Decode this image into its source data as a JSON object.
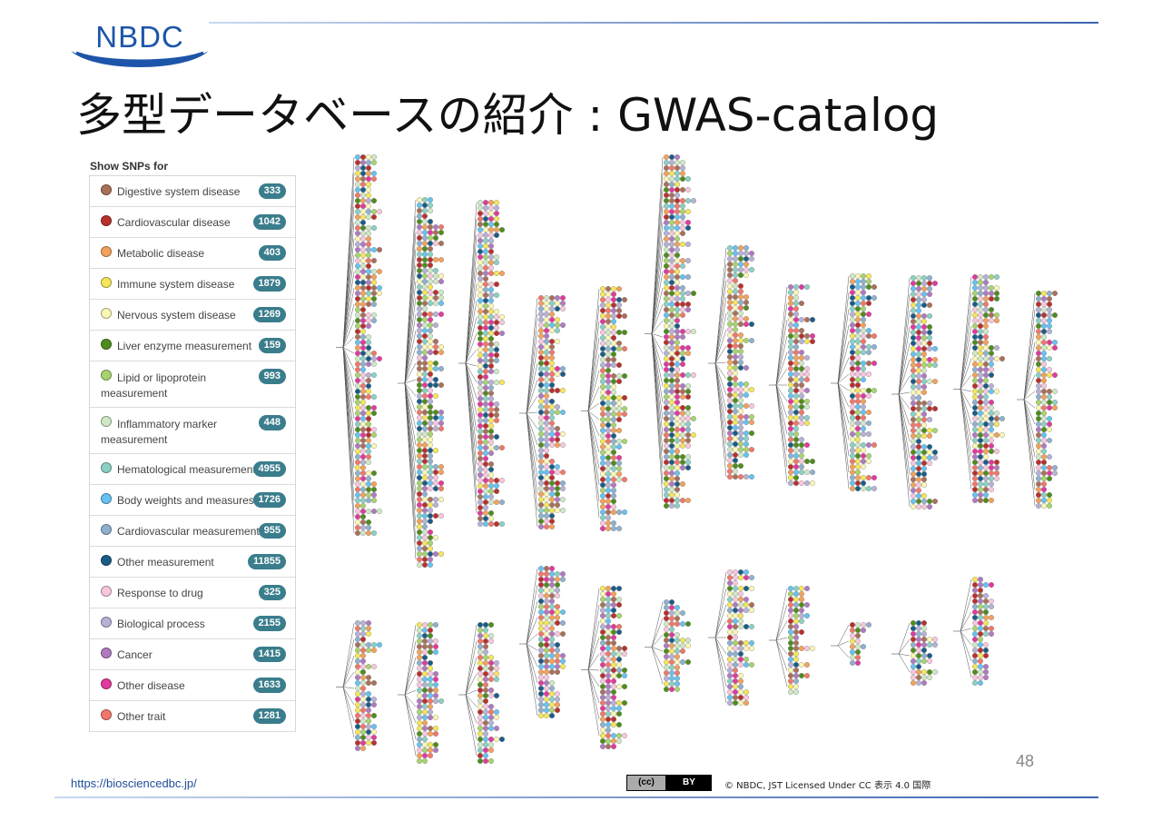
{
  "logo": {
    "text": "NBDC",
    "color": "#1c55a9"
  },
  "title": "多型データベースの紹介 : GWAS-catalog",
  "panel": {
    "heading": "Show SNPs for",
    "items": [
      {
        "label": "Digestive system disease",
        "count": "333",
        "color": "#a9705a"
      },
      {
        "label": "Cardiovascular disease",
        "count": "1042",
        "color": "#b8312f"
      },
      {
        "label": "Metabolic disease",
        "count": "403",
        "color": "#f2a25c"
      },
      {
        "label": "Immune system disease",
        "count": "1879",
        "color": "#f5e65a"
      },
      {
        "label": "Nervous system disease",
        "count": "1269",
        "color": "#fbf7b5"
      },
      {
        "label": "Liver enzyme measurement",
        "count": "159",
        "color": "#4f8c1e"
      },
      {
        "label": "Lipid or lipoprotein measurement",
        "count": "993",
        "color": "#a8d46f"
      },
      {
        "label": "Inflammatory marker measurement",
        "count": "448",
        "color": "#cfe8c6"
      },
      {
        "label": "Hematological measurement",
        "count": "4955",
        "color": "#8ad1c4"
      },
      {
        "label": "Body weights and measures",
        "count": "1726",
        "color": "#66c2f0"
      },
      {
        "label": "Cardiovascular measurement",
        "count": "955",
        "color": "#8fb1cf"
      },
      {
        "label": "Other measurement",
        "count": "11855",
        "color": "#1b5c87"
      },
      {
        "label": "Response to drug",
        "count": "325",
        "color": "#f7c7de"
      },
      {
        "label": "Biological process",
        "count": "2155",
        "color": "#b6b2d6"
      },
      {
        "label": "Cancer",
        "count": "1415",
        "color": "#b07ac0"
      },
      {
        "label": "Other disease",
        "count": "1633",
        "color": "#e13a9c"
      },
      {
        "label": "Other trait",
        "count": "1281",
        "color": "#f0786a"
      }
    ]
  },
  "badge_color": "#3a7d8c",
  "page_number": "48",
  "footer": {
    "url": "https://biosciencedbc.jp/",
    "cc_left": "(cc)",
    "cc_right": "BY",
    "license": "© NBDC, JST    Licensed Under CC 表示 4.0 国際"
  }
}
